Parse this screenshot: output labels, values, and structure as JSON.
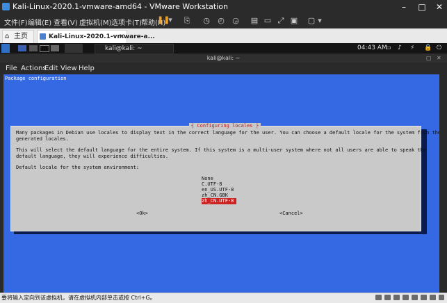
{
  "window": {
    "title": "Kali-Linux-2020.1-vmware-amd64 - VMware Workstation",
    "controls": [
      "–",
      "□",
      "✕"
    ]
  },
  "vm_menu": [
    "文件(F)",
    "编辑(E)",
    "查看(V)",
    "虚拟机(M)",
    "选项卡(T)",
    "帮助(H)"
  ],
  "tabs": [
    {
      "label": "主页"
    },
    {
      "label": "Kali-Linux-2020.1-vmware-a...",
      "close": "×"
    }
  ],
  "guest_panel": {
    "terminal_task": "kali@kali: ~",
    "clock": "04:43 AM"
  },
  "terminal": {
    "title": "kali@kali: ~",
    "menu": [
      "File",
      "Actions",
      "Edit",
      "View",
      "Help"
    ]
  },
  "screen": {
    "header": "Package configuration",
    "dialog": {
      "title": "Configuring locales",
      "lines": [
        "Many packages in Debian use locales to display text in the correct language for the user. You can choose a default locale for the system from the",
        "generated locales.",
        "",
        "This will select the default language for the entire system. If this system is a multi-user system where not all users are able to speak the",
        "default language, they will experience difficulties.",
        "",
        "Default locale for the system environment:"
      ],
      "options": [
        "None",
        "C.UTF-8",
        "en_US.UTF-8",
        "zh_CN.GBK",
        "zh_CN.UTF-8"
      ],
      "selected_index": 4,
      "ok": "<Ok>",
      "cancel": "<Cancel>"
    }
  },
  "status_bar": {
    "text": "要将输入定向到该虚拟机，请在虚拟机内部单击或按 Ctrl+G。"
  },
  "colors": {
    "dialog_bg": "#c9c9c9",
    "screen_bg": "#3469e3",
    "selected_bg": "#cc2222",
    "title_red": "#b02020"
  }
}
